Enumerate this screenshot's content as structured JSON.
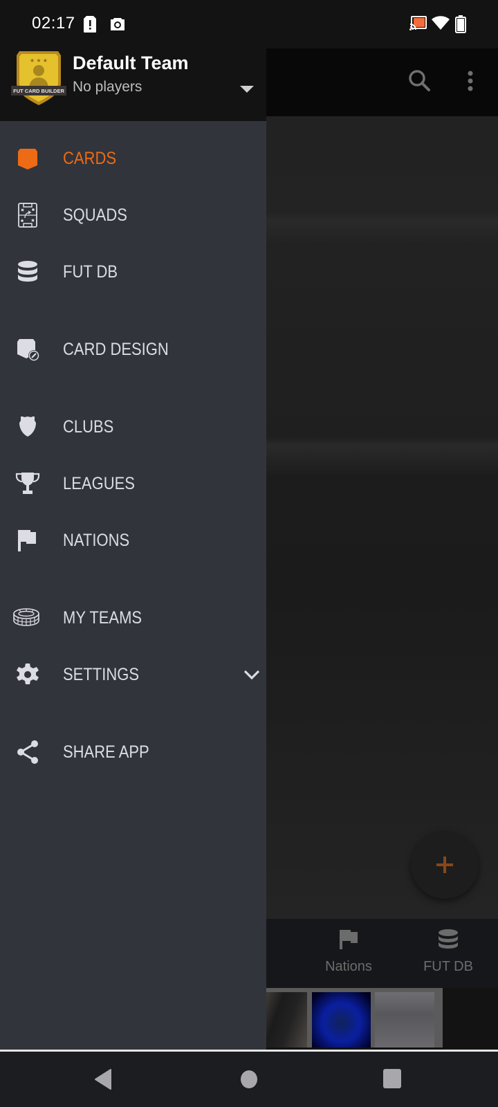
{
  "status_bar": {
    "time": "02:17",
    "left_icons": [
      "sim-alert-icon",
      "camera-icon"
    ],
    "right_icons": [
      "cast-icon",
      "wifi-icon",
      "battery-icon"
    ],
    "cast_color": "#f26b3a"
  },
  "drawer": {
    "header": {
      "badge_label": "FUT CARD BUILDER",
      "team_name": "Default Team",
      "team_subtitle": "No players"
    },
    "items": [
      {
        "id": "cards",
        "label": "CARDS",
        "icon": "card-icon",
        "active": true
      },
      {
        "id": "squads",
        "label": "SQUADS",
        "icon": "tactics-board-icon",
        "active": false
      },
      {
        "id": "fut-db",
        "label": "FUT DB",
        "icon": "database-icon",
        "active": false
      },
      {
        "id": "card-design",
        "label": "CARD DESIGN",
        "icon": "card-edit-icon",
        "active": false
      },
      {
        "id": "clubs",
        "label": "CLUBS",
        "icon": "shield-icon",
        "active": false
      },
      {
        "id": "leagues",
        "label": "LEAGUES",
        "icon": "trophy-icon",
        "active": false
      },
      {
        "id": "nations",
        "label": "NATIONS",
        "icon": "flag-icon",
        "active": false
      },
      {
        "id": "my-teams",
        "label": "MY TEAMS",
        "icon": "stadium-icon",
        "active": false
      },
      {
        "id": "settings",
        "label": "SETTINGS",
        "icon": "gear-icon",
        "active": false,
        "expandable": true
      },
      {
        "id": "share-app",
        "label": "SHARE APP",
        "icon": "share-icon",
        "active": false
      }
    ]
  },
  "app": {
    "toolbar_icons": [
      "search-icon",
      "more-vert-icon"
    ],
    "fab_icon": "plus-icon",
    "bottom_nav": [
      {
        "label": "Nations",
        "icon": "flag-icon"
      },
      {
        "label": "FUT DB",
        "icon": "database-icon"
      }
    ]
  },
  "colors": {
    "accent": "#ec6b14",
    "drawer_bg": "#32343b",
    "header_bg": "#131313",
    "text_inactive": "#dcdce4"
  },
  "system_nav": [
    "back-button",
    "home-button",
    "recents-button"
  ]
}
